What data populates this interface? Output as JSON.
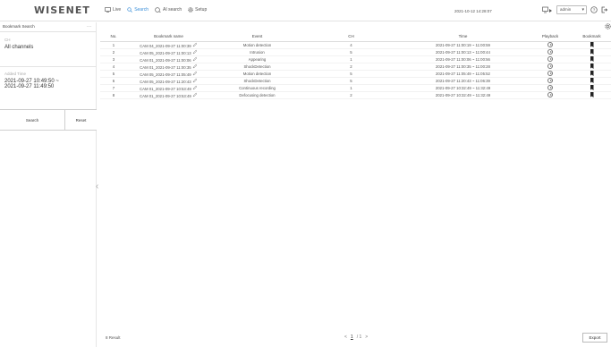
{
  "app": {
    "logo": "WISENET"
  },
  "menu": [
    {
      "label": "Live",
      "icon": "monitor-icon",
      "active": false
    },
    {
      "label": "Search",
      "icon": "search-icon",
      "active": true
    },
    {
      "label": "AI search",
      "icon": "ai-search-icon",
      "active": false
    },
    {
      "label": "Setup",
      "icon": "gear-icon",
      "active": false
    }
  ],
  "header": {
    "datetime": "2021-10-12 14:28:07",
    "user": "admin"
  },
  "sidebar": {
    "title": "Bookmark Search",
    "channel_label": "CH",
    "channel_value": "All channels",
    "time_label": "Added Time",
    "time_value_1": "2021-09-27 10:49:50 ~",
    "time_value_2": "2021-09-27 11:49:50",
    "search_button": "Search",
    "reset_button": "Reset"
  },
  "table": {
    "columns": [
      "No.",
      "Bookmark name",
      "Event",
      "CH",
      "Time",
      "Playback",
      "Bookmark"
    ],
    "rows": [
      {
        "no": "1",
        "name": "CAM 04_2021-09-27 11:00:39",
        "event": "Motion detection",
        "ch": "4",
        "time": "2021-09-27 11:00:19 ~ 11:00:59"
      },
      {
        "no": "2",
        "name": "CAM 05_2021-09-27 11:00:13",
        "event": "Intrusion",
        "ch": "5",
        "time": "2021-09-27 11:00:13 ~ 11:00:44"
      },
      {
        "no": "3",
        "name": "CAM 01_2021-09-27 11:00:06",
        "event": "Appearing",
        "ch": "1",
        "time": "2021-09-27 11:00:06 ~ 11:00:56"
      },
      {
        "no": "4",
        "name": "CAM 01_2021-09-27 11:00:35",
        "event": "ShockDetection",
        "ch": "2",
        "time": "2021-09-27 11:00:35 ~ 11:00:28"
      },
      {
        "no": "5",
        "name": "CAM 05_2021-09-27 11:05:49",
        "event": "Motion detection",
        "ch": "5",
        "time": "2021-09-27 11:05:49 ~ 11:05:52"
      },
      {
        "no": "6",
        "name": "CAM 05_2021-09-27 11:20:43",
        "event": "ShockDetection",
        "ch": "5",
        "time": "2021-09-27 11:20:43 ~ 11:06:39"
      },
      {
        "no": "7",
        "name": "CAM 01_2021-09-27 10:53:49",
        "event": "Continuous recording",
        "ch": "1",
        "time": "2021-09-27 10:32:49 ~ 11:32:49"
      },
      {
        "no": "8",
        "name": "CAM 01_2021-09-27 10:53:49",
        "event": "Defocusing detection",
        "ch": "2",
        "time": "2021-09-27 10:32:49 ~ 11:32:49"
      }
    ]
  },
  "footer": {
    "result": "8 Result",
    "pager_prev": "<",
    "pager_page": "1",
    "pager_total": "/ 1",
    "pager_next": ">",
    "export": "Export"
  }
}
